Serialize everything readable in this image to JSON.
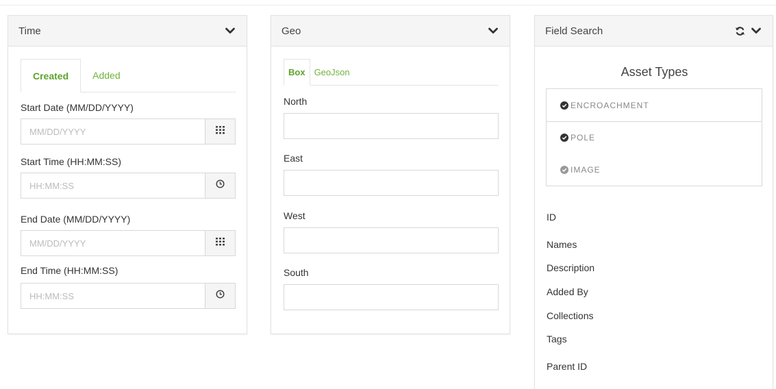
{
  "time_panel": {
    "title": "Time",
    "tabs": [
      {
        "label": "Created",
        "active": true
      },
      {
        "label": "Added",
        "active": false
      }
    ],
    "fields": [
      {
        "label": "Start Date (MM/DD/YYYY)",
        "placeholder": "MM/DD/YYYY",
        "value": "",
        "icon": "calendar-icon"
      },
      {
        "label": "Start Time (HH:MM:SS)",
        "placeholder": "HH:MM:SS",
        "value": "",
        "icon": "clock-icon"
      },
      {
        "label": "End Date (MM/DD/YYYY)",
        "placeholder": "MM/DD/YYYY",
        "value": "",
        "icon": "calendar-icon"
      },
      {
        "label": "End Time (HH:MM:SS)",
        "placeholder": "HH:MM:SS",
        "value": "",
        "icon": "clock-icon"
      }
    ]
  },
  "geo_panel": {
    "title": "Geo",
    "tabs": [
      {
        "label": "Box",
        "active": true
      },
      {
        "label": "GeoJson",
        "active": false
      }
    ],
    "fields": [
      {
        "label": "North",
        "value": ""
      },
      {
        "label": "East",
        "value": ""
      },
      {
        "label": "West",
        "value": ""
      },
      {
        "label": "South",
        "value": ""
      }
    ]
  },
  "field_search_panel": {
    "title": "Field Search",
    "asset_types_heading": "Asset Types",
    "asset_types": [
      {
        "label": "ENCROACHMENT",
        "checked": true
      },
      {
        "label": "POLE",
        "checked": true
      },
      {
        "label": "IMAGE",
        "checked": false
      }
    ],
    "fields": [
      "ID",
      "Names",
      "Description",
      "Added By",
      "Collections",
      "Tags",
      "Parent ID"
    ]
  },
  "colors": {
    "accent_green": "#6fb33a",
    "header_bg": "#f5f5f5",
    "border": "#d8d8d8"
  }
}
